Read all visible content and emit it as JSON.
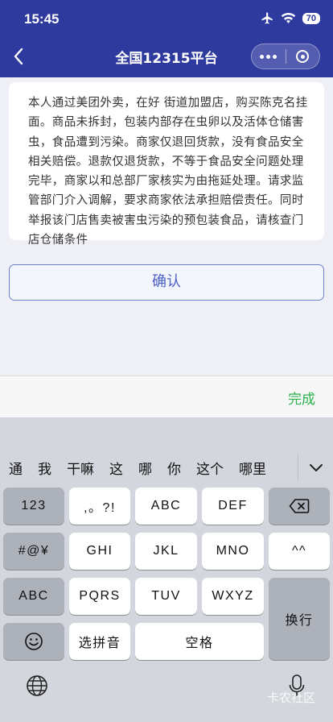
{
  "status_bar": {
    "time": "15:45",
    "battery": "70"
  },
  "nav": {
    "title": "全国12315平台"
  },
  "complaint": {
    "text": "本人通过美团外卖，在好                街道加盟店，购买陈克名挂面。商品未拆封，包装内部存在虫卵以及活体仓储害虫，食品遭到污染。商家仅退回货款，没有食品安全相关赔偿。退款仅退货款，不等于食品安全问题处理完毕，商家以和总部厂家核实为由拖延处理。请求监管部门介入调解，要求商家依法承担赔偿责任。同时举报该门店售卖被害虫污染的预包装食品，请核查门店仓储条件"
  },
  "confirm_label": "确认",
  "done_label": "完成",
  "candidates": [
    "通",
    "我",
    "干嘛",
    "这",
    "哪",
    "你",
    "这个",
    "哪里"
  ],
  "keys": {
    "num": "123",
    "punct": ",。?!",
    "abc1": "ABC",
    "def": "DEF",
    "symbols": "#@¥",
    "ghi": "GHI",
    "jkl": "JKL",
    "mno": "MNO",
    "emoticon": "^^",
    "abc_switch": "ABC",
    "pqrs": "PQRS",
    "tuv": "TUV",
    "wxyz": "WXYZ",
    "newline": "换行",
    "pinyin": "选拼音",
    "space": "空格"
  },
  "watermark": "卡农社区"
}
